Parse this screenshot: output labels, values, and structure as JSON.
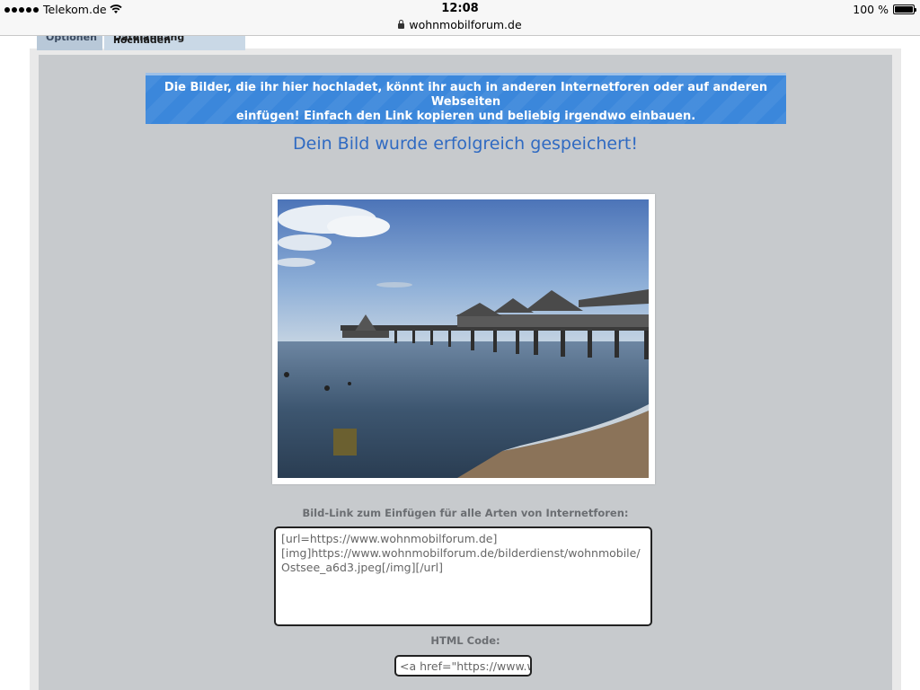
{
  "status_bar": {
    "carrier": "Telekom.de",
    "time": "12:08",
    "url": "wohnmobilforum.de",
    "battery": "100 %",
    "battery_level_percent": 100,
    "signal_icon": "signal-dots-icon",
    "wifi_icon": "wifi-icon",
    "lock_icon": "lock-icon"
  },
  "tabs": [
    {
      "label": "Optionen"
    },
    {
      "label": "Dateianhang hochladen"
    }
  ],
  "banner": {
    "line1": "Die Bilder, die ihr hier hochladet, könnt ihr auch in anderen Internetforen oder auf anderen Webseiten",
    "line2": "einfügen! Einfach den Link kopieren und beliebig irgendwo einbauen."
  },
  "success_message": "Dein Bild wurde erfolgreich gespeichert!",
  "bbcode": {
    "label": "Bild-Link zum Einfügen für alle Arten von Internetforen:",
    "value": "[url=https://www.wohnmobilforum.de]\n[img]https://www.wohnmobilforum.de/bilderdienst/wohnmobile/Ostsee_a6d3.jpeg[/img][/url]"
  },
  "html_code": {
    "label": "HTML Code:",
    "value": "<a href=\"https://www.wo"
  },
  "colors": {
    "banner": "#3b87db",
    "success_text": "#2f6ac2",
    "content_bg": "#c7cacd"
  }
}
